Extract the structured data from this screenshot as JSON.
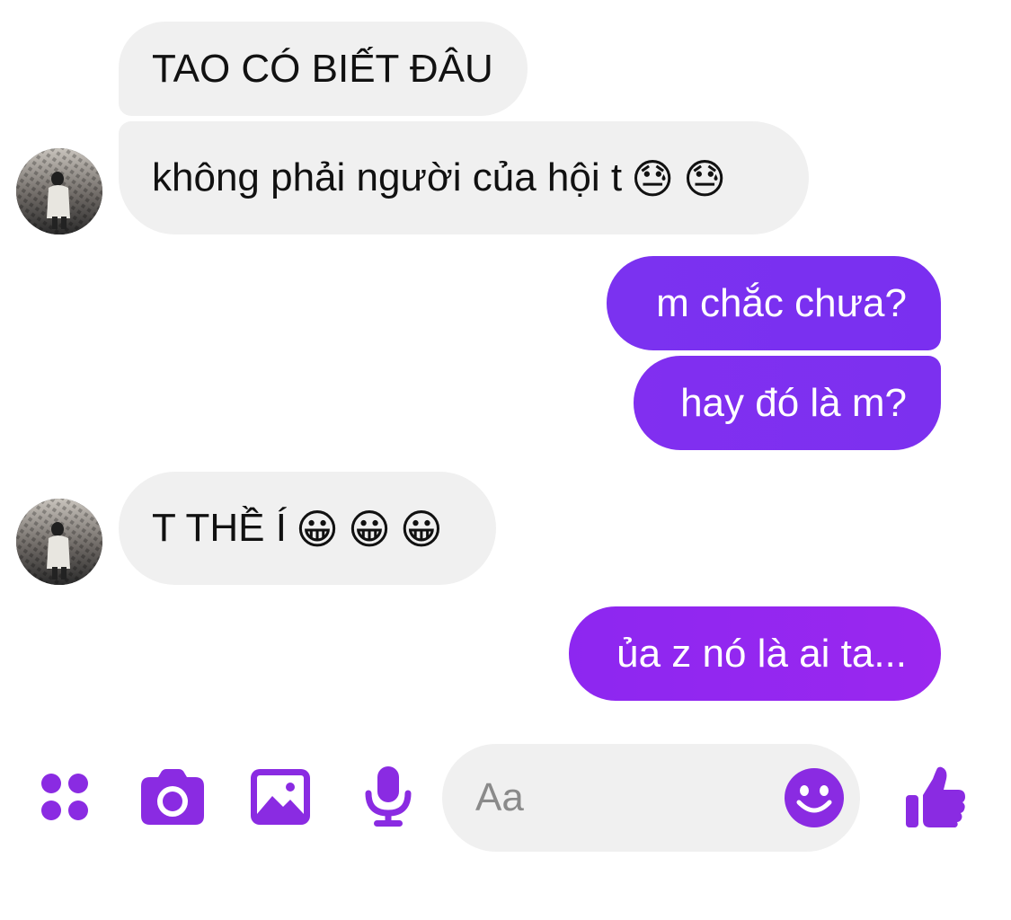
{
  "theme": {
    "accent": "#8a2be2",
    "outgoing_gradient": [
      "#7b32f0",
      "#9b27ef"
    ],
    "incoming_bubble": "#f0f0f0"
  },
  "messages": [
    {
      "direction": "incoming",
      "text": "TAO CÓ BIẾT ĐÂU",
      "emojis": []
    },
    {
      "direction": "incoming",
      "text": "không phải người của hội t",
      "emojis": [
        "😓",
        "😓"
      ],
      "has_avatar": true
    },
    {
      "direction": "outgoing",
      "text": "m chắc chưa?"
    },
    {
      "direction": "outgoing",
      "text": "hay đó là m?"
    },
    {
      "direction": "incoming",
      "text": "T THỀ Í",
      "emojis": [
        "😀",
        "😀",
        "😀"
      ],
      "has_avatar": true
    },
    {
      "direction": "outgoing",
      "text": "ủa z nó là ai ta..."
    }
  ],
  "composer": {
    "placeholder": "Aa",
    "icons": [
      "apps-icon",
      "camera-icon",
      "image-icon",
      "microphone-icon",
      "emoji-icon",
      "like-icon"
    ]
  }
}
